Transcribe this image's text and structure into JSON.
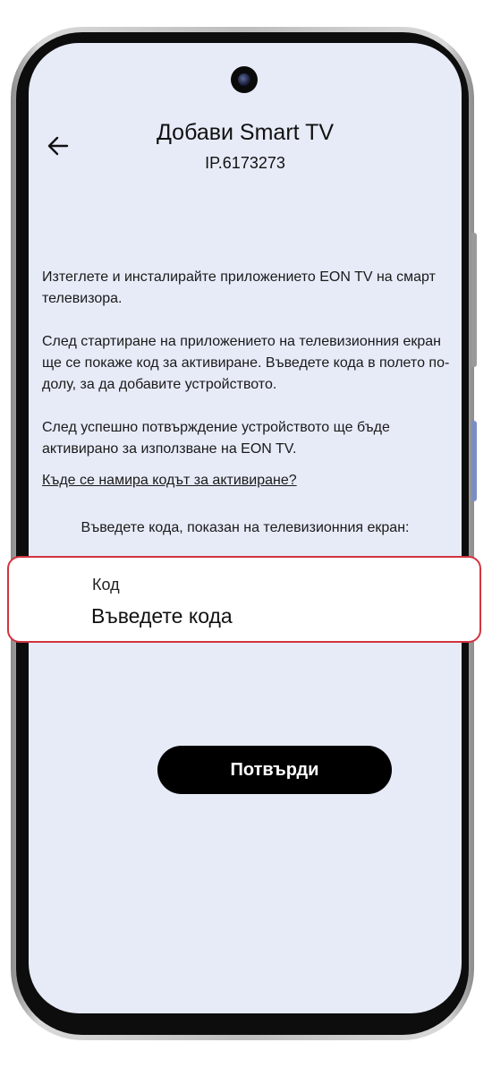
{
  "header": {
    "title": "Добави Smart TV",
    "subtitle": "IP.6173273"
  },
  "icons": {
    "back": "arrow-left-icon",
    "camera": "front-camera"
  },
  "instructions": {
    "paragraph1": "Изтеглете и инсталирайте приложението EON TV на смарт телевизора.",
    "paragraph2": "След стартиране на приложението на телевизионния екран ще се покаже код за активиране. Въведете кода в полето по-долу, за да добавите устройството.",
    "paragraph3": "След успешно потвърждение устройството ще бъде активирано за използване на EON TV."
  },
  "help_link": "Къде се намира кодът за активиране?",
  "code_prompt": "Въведете кода, показан на телевизионния екран:",
  "code_field": {
    "label": "Код",
    "placeholder": "Въведете кода",
    "value": ""
  },
  "confirm_button": "Потвърди",
  "colors": {
    "screen_background": "#e7ebf8",
    "field_border": "#d2343f",
    "button_background": "#000000",
    "button_text": "#ffffff"
  }
}
